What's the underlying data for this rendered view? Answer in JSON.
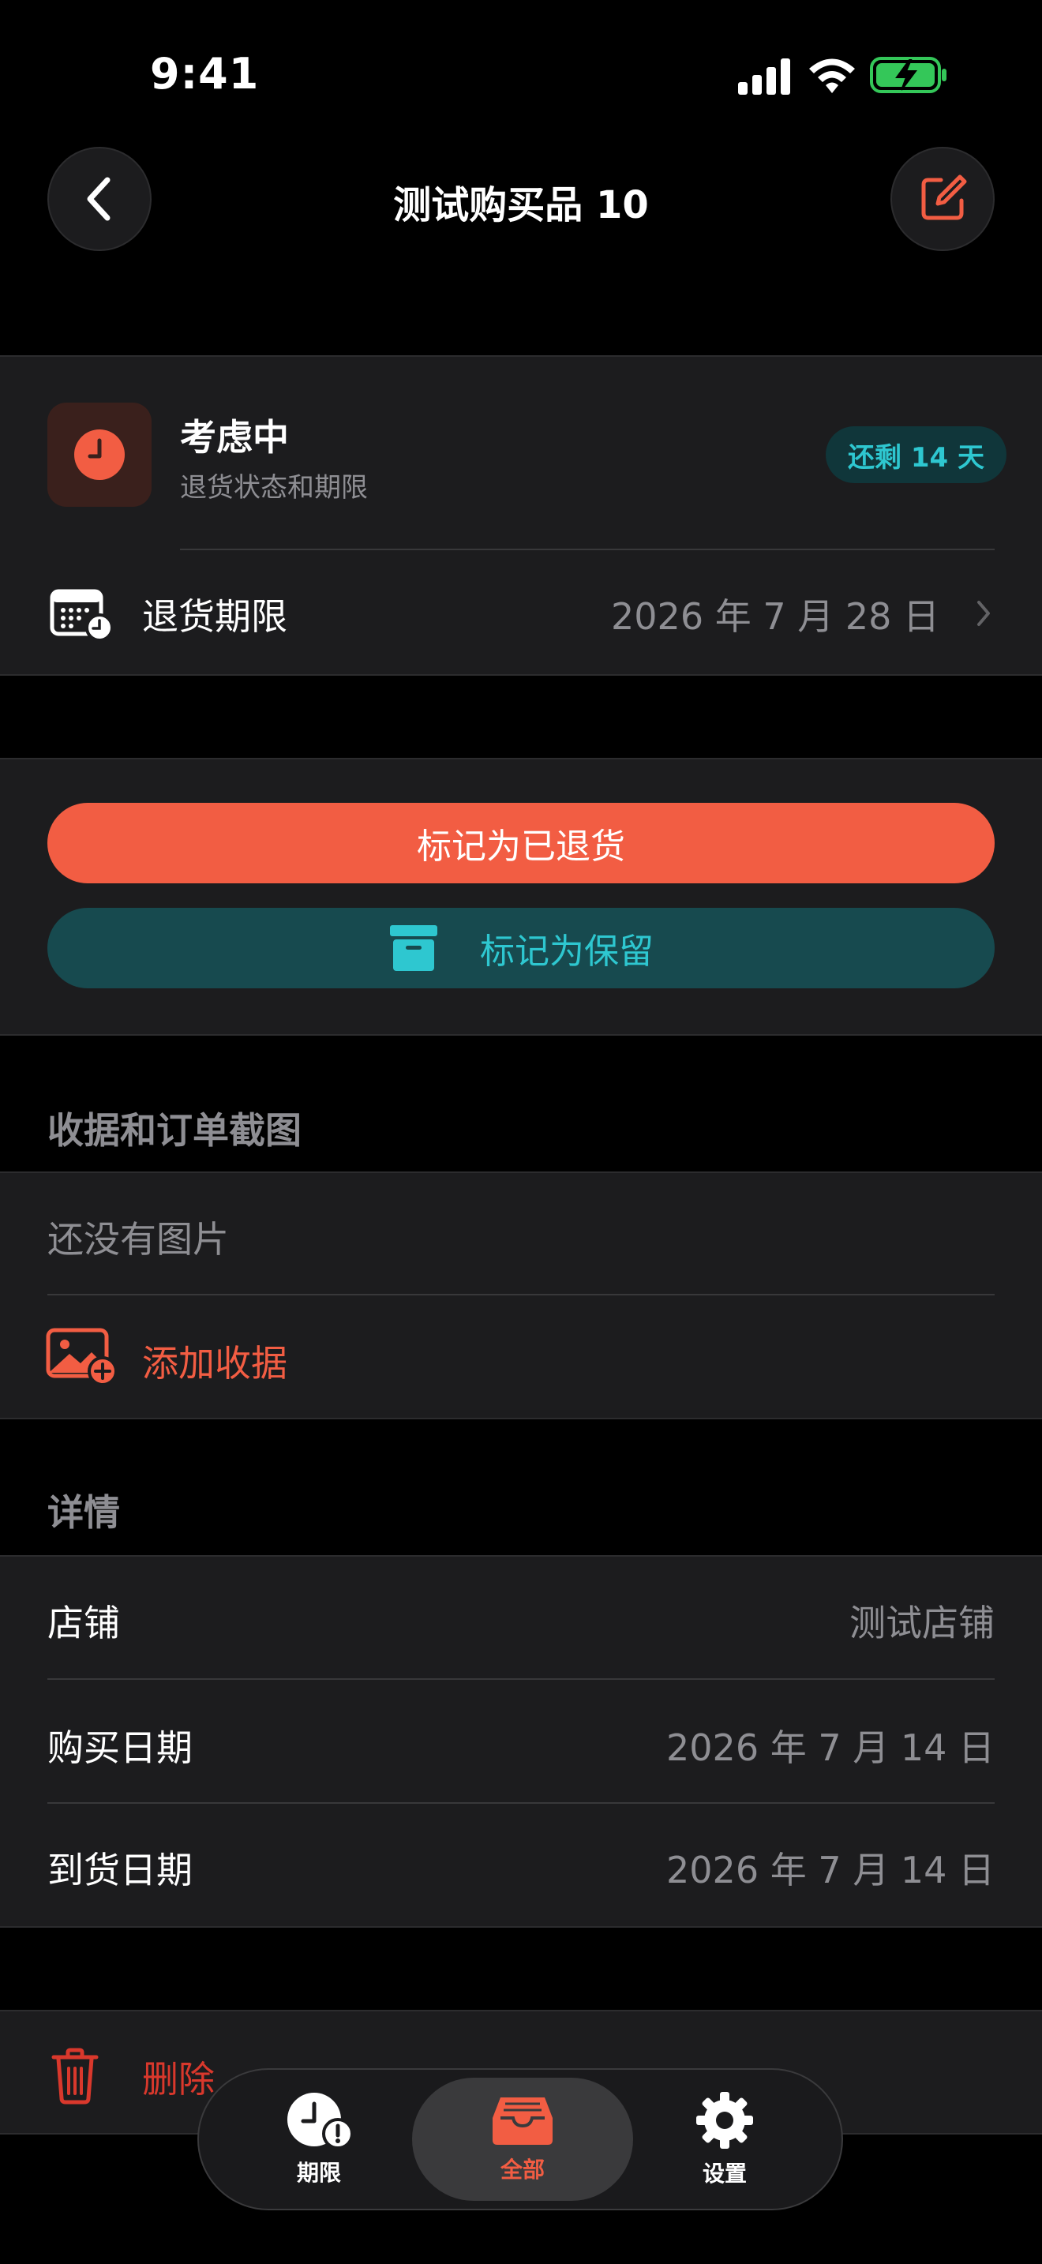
{
  "status_bar": {
    "time": "9:41"
  },
  "nav": {
    "title": "测试购买品 10"
  },
  "status_card": {
    "title": "考虑中",
    "subtitle": "退货状态和期限",
    "badge": "还剩 14 天",
    "deadline_label": "退货期限",
    "deadline_value": "2026 年 7 月 28 日"
  },
  "actions": {
    "mark_returned": "标记为已退货",
    "mark_kept": "标记为保留"
  },
  "receipts": {
    "header": "收据和订单截图",
    "empty_text": "还没有图片",
    "add_label": "添加收据"
  },
  "details": {
    "header": "详情",
    "rows": [
      {
        "label": "店铺",
        "value": "测试店铺"
      },
      {
        "label": "购买日期",
        "value": "2026 年 7 月 14 日"
      },
      {
        "label": "到货日期",
        "value": "2026 年 7 月 14 日"
      }
    ]
  },
  "delete": {
    "label": "删除"
  },
  "tabbar": {
    "tabs": [
      {
        "label": "期限",
        "icon": "clock-alert-icon"
      },
      {
        "label": "全部",
        "icon": "tray-icon",
        "active": true
      },
      {
        "label": "设置",
        "icon": "gear-icon"
      }
    ]
  },
  "colors": {
    "accent": "#f25d43",
    "teal": "#2ec7d0",
    "teal_bg": "#174a4f",
    "card": "#1c1c1e",
    "secondary_text": "#8e8e93"
  }
}
